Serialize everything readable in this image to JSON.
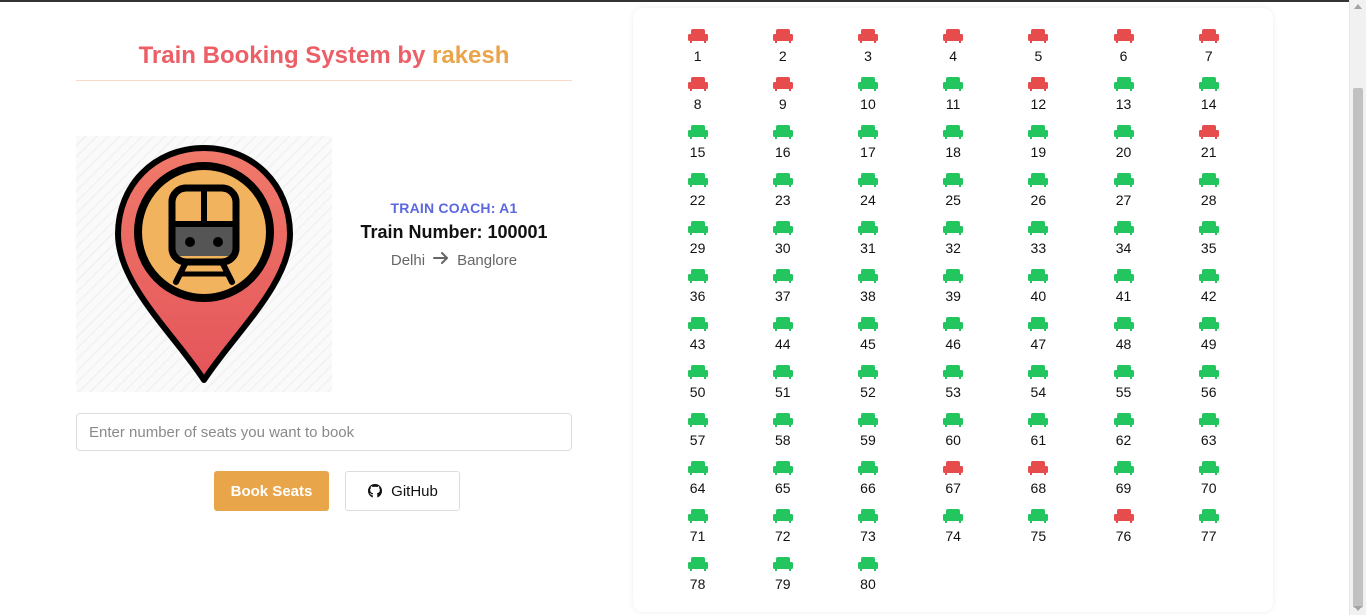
{
  "header": {
    "title_main": "Train Booking System by",
    "title_author": "rakesh"
  },
  "train": {
    "coach_label": "TRAIN COACH: A1",
    "number_label": "Train Number: 100001",
    "from": "Delhi",
    "to": "Banglore"
  },
  "booking": {
    "input_placeholder": "Enter number of seats you want to book",
    "input_value": "",
    "book_button": "Book Seats",
    "github_button": "GitHub"
  },
  "colors": {
    "booked": "#e74c4c",
    "available": "#22c55e",
    "title_red": "#ec5f67",
    "title_orange": "#eaa44a",
    "book_button_bg": "#e9a54a",
    "coach_label": "#5b67e0"
  },
  "icons": {
    "seat": "sofa-seat-icon",
    "route_arrow": "arrow-right-icon",
    "github": "github-icon",
    "hero": "train-location-pin-icon"
  },
  "seats": [
    {
      "n": "1",
      "s": "booked"
    },
    {
      "n": "2",
      "s": "booked"
    },
    {
      "n": "3",
      "s": "booked"
    },
    {
      "n": "4",
      "s": "booked"
    },
    {
      "n": "5",
      "s": "booked"
    },
    {
      "n": "6",
      "s": "booked"
    },
    {
      "n": "7",
      "s": "booked"
    },
    {
      "n": "8",
      "s": "booked"
    },
    {
      "n": "9",
      "s": "booked"
    },
    {
      "n": "10",
      "s": "available"
    },
    {
      "n": "11",
      "s": "available"
    },
    {
      "n": "12",
      "s": "booked"
    },
    {
      "n": "13",
      "s": "available"
    },
    {
      "n": "14",
      "s": "available"
    },
    {
      "n": "15",
      "s": "available"
    },
    {
      "n": "16",
      "s": "available"
    },
    {
      "n": "17",
      "s": "available"
    },
    {
      "n": "18",
      "s": "available"
    },
    {
      "n": "19",
      "s": "available"
    },
    {
      "n": "20",
      "s": "available"
    },
    {
      "n": "21",
      "s": "booked"
    },
    {
      "n": "22",
      "s": "available"
    },
    {
      "n": "23",
      "s": "available"
    },
    {
      "n": "24",
      "s": "available"
    },
    {
      "n": "25",
      "s": "available"
    },
    {
      "n": "26",
      "s": "available"
    },
    {
      "n": "27",
      "s": "available"
    },
    {
      "n": "28",
      "s": "available"
    },
    {
      "n": "29",
      "s": "available"
    },
    {
      "n": "30",
      "s": "available"
    },
    {
      "n": "31",
      "s": "available"
    },
    {
      "n": "32",
      "s": "available"
    },
    {
      "n": "33",
      "s": "available"
    },
    {
      "n": "34",
      "s": "available"
    },
    {
      "n": "35",
      "s": "available"
    },
    {
      "n": "36",
      "s": "available"
    },
    {
      "n": "37",
      "s": "available"
    },
    {
      "n": "38",
      "s": "available"
    },
    {
      "n": "39",
      "s": "available"
    },
    {
      "n": "40",
      "s": "available"
    },
    {
      "n": "41",
      "s": "available"
    },
    {
      "n": "42",
      "s": "available"
    },
    {
      "n": "43",
      "s": "available"
    },
    {
      "n": "44",
      "s": "available"
    },
    {
      "n": "45",
      "s": "available"
    },
    {
      "n": "46",
      "s": "available"
    },
    {
      "n": "47",
      "s": "available"
    },
    {
      "n": "48",
      "s": "available"
    },
    {
      "n": "49",
      "s": "available"
    },
    {
      "n": "50",
      "s": "available"
    },
    {
      "n": "51",
      "s": "available"
    },
    {
      "n": "52",
      "s": "available"
    },
    {
      "n": "53",
      "s": "available"
    },
    {
      "n": "54",
      "s": "available"
    },
    {
      "n": "55",
      "s": "available"
    },
    {
      "n": "56",
      "s": "available"
    },
    {
      "n": "57",
      "s": "available"
    },
    {
      "n": "58",
      "s": "available"
    },
    {
      "n": "59",
      "s": "available"
    },
    {
      "n": "60",
      "s": "available"
    },
    {
      "n": "61",
      "s": "available"
    },
    {
      "n": "62",
      "s": "available"
    },
    {
      "n": "63",
      "s": "available"
    },
    {
      "n": "64",
      "s": "available"
    },
    {
      "n": "65",
      "s": "available"
    },
    {
      "n": "66",
      "s": "available"
    },
    {
      "n": "67",
      "s": "booked"
    },
    {
      "n": "68",
      "s": "booked"
    },
    {
      "n": "69",
      "s": "available"
    },
    {
      "n": "70",
      "s": "available"
    },
    {
      "n": "71",
      "s": "available"
    },
    {
      "n": "72",
      "s": "available"
    },
    {
      "n": "73",
      "s": "available"
    },
    {
      "n": "74",
      "s": "available"
    },
    {
      "n": "75",
      "s": "available"
    },
    {
      "n": "76",
      "s": "booked"
    },
    {
      "n": "77",
      "s": "available"
    },
    {
      "n": "78",
      "s": "available"
    },
    {
      "n": "79",
      "s": "available"
    },
    {
      "n": "80",
      "s": "available"
    }
  ]
}
